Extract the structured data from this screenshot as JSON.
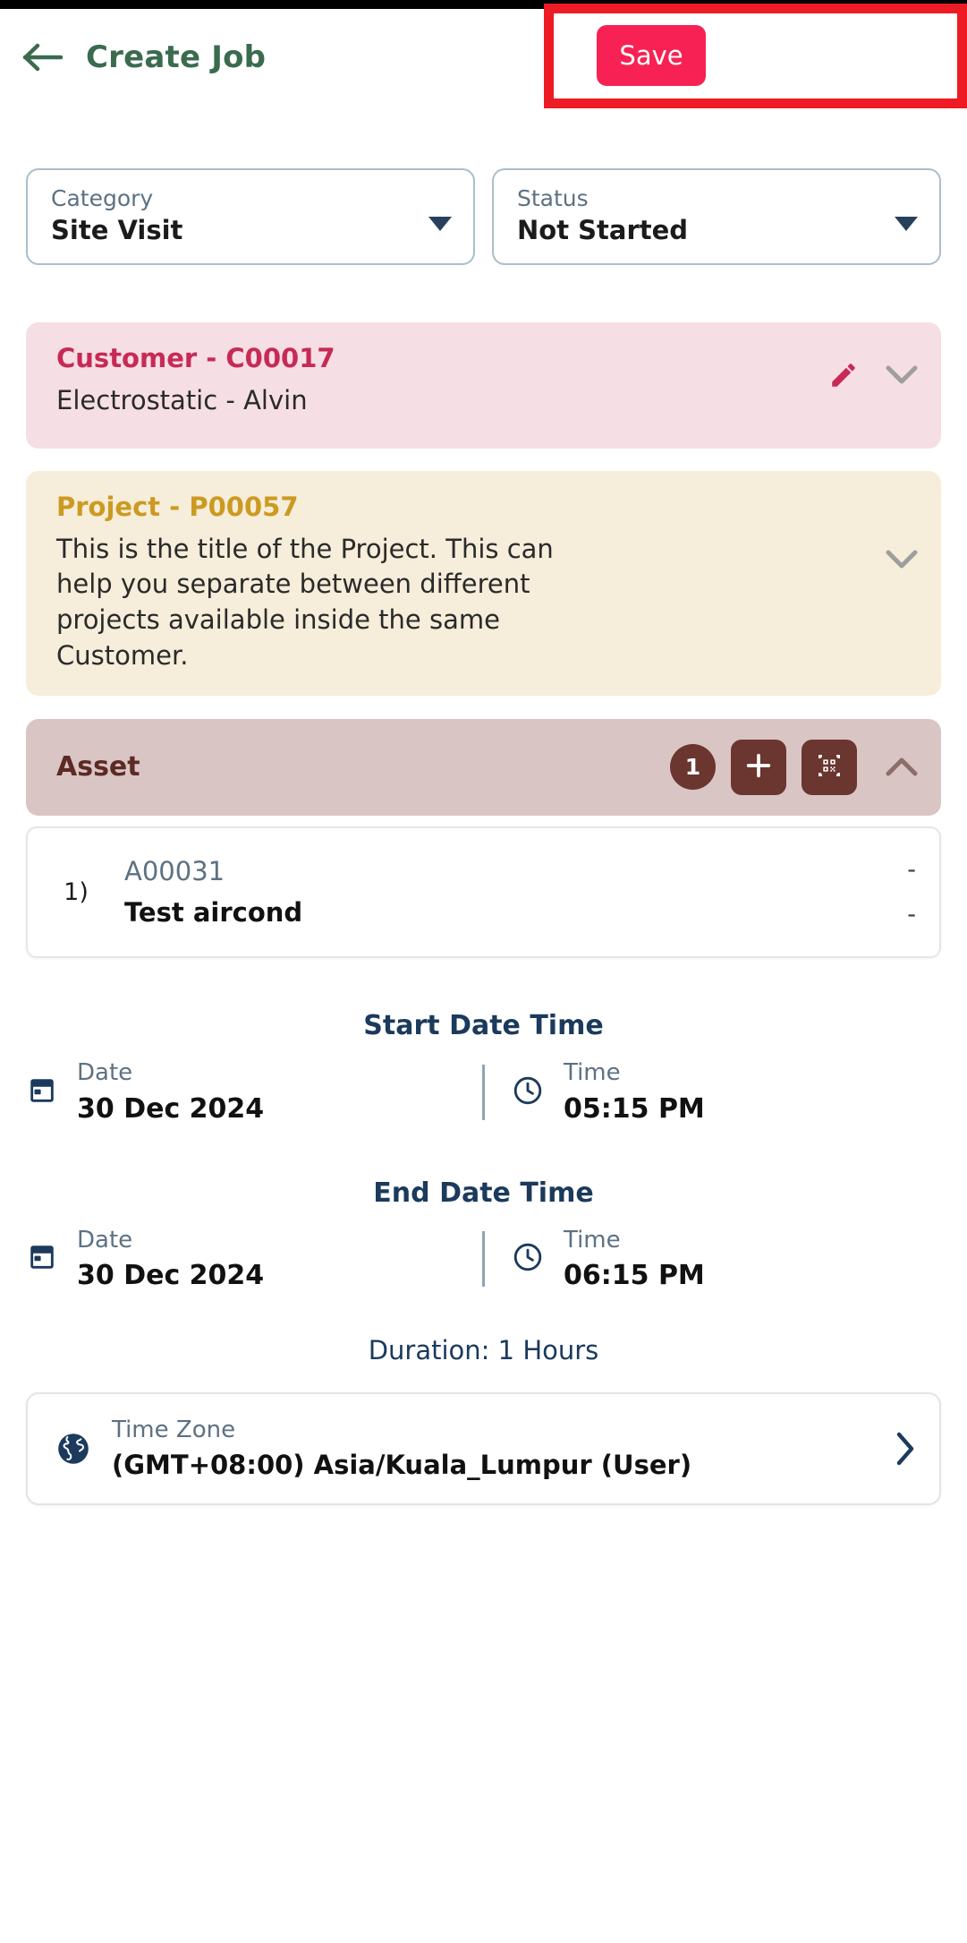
{
  "header": {
    "back_icon": "arrow-left-icon",
    "title": "Create Job",
    "save_label": "Save",
    "accent_save_bg": "#F72253",
    "annotation_color": "#ED1C24",
    "title_color": "#3A6B4E"
  },
  "fields": {
    "category": {
      "label": "Category",
      "value": "Site Visit",
      "caret_icon": "chevron-down-icon"
    },
    "status": {
      "label": "Status",
      "value": "Not Started",
      "caret_icon": "chevron-down-icon"
    }
  },
  "customer_card": {
    "title": "Customer  -  C00017",
    "body": "Electrostatic  - Alvin",
    "bg_color": "#F6DEE5",
    "title_color": "#C62B55",
    "edit_icon": "pencil-edit-icon",
    "expand_icon": "chevron-down-icon"
  },
  "project_card": {
    "title": "Project  -  P00057",
    "body": "This is the title of the Project. This can help you separate between different projects available inside the same Customer.",
    "bg_color": "#F6EDDA",
    "title_color": "#CC9A20",
    "expand_icon": "chevron-down-icon"
  },
  "asset_section": {
    "title": "Asset",
    "count": "1",
    "bg_color": "#D9C6C4",
    "button_color": "#6B3530",
    "add_icon": "plus-icon",
    "scan_icon": "qr-code-scan-icon",
    "collapse_icon": "chevron-up-icon",
    "rows": [
      {
        "index": "1)",
        "code": "A00031",
        "name": "Test aircond",
        "dash_top": "-",
        "dash_bottom": "-"
      }
    ]
  },
  "start_datetime": {
    "heading": "Start Date Time",
    "date_label": "Date",
    "date_value": "30 Dec 2024",
    "time_label": "Time",
    "time_value": "05:15 PM",
    "date_icon": "calendar-icon",
    "time_icon": "clock-icon"
  },
  "end_datetime": {
    "heading": "End Date Time",
    "date_label": "Date",
    "date_value": "30 Dec 2024",
    "time_label": "Time",
    "time_value": "06:15 PM",
    "date_icon": "calendar-icon",
    "time_icon": "clock-icon"
  },
  "duration": {
    "text": "Duration: 1 Hours"
  },
  "time_zone": {
    "label": "Time Zone",
    "value": "(GMT+08:00) Asia/Kuala_Lumpur (User)",
    "globe_icon": "globe-icon",
    "chevron_icon": "chevron-right-icon"
  }
}
